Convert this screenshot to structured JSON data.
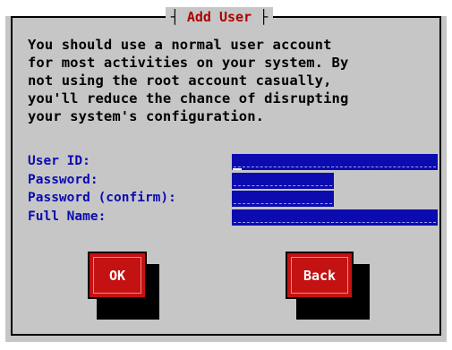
{
  "dialog": {
    "title": "Add User",
    "message": "You should use a normal user account\nfor most activities on your system. By\nnot using the root account casually,\nyou'll reduce the chance of disrupting\nyour system's configuration."
  },
  "form": {
    "fields": [
      {
        "label": "User ID:",
        "value": ""
      },
      {
        "label": "Password:",
        "value": ""
      },
      {
        "label": "Password (confirm):",
        "value": ""
      },
      {
        "label": "Full Name:",
        "value": ""
      }
    ]
  },
  "buttons": {
    "ok_label": "OK",
    "back_label": "Back"
  },
  "colors": {
    "dialog_bg": "#c6c6c6",
    "title": "#b00000",
    "label": "#0a0ab0",
    "field_bg": "#0b0baf",
    "button_bg": "#c41212"
  }
}
